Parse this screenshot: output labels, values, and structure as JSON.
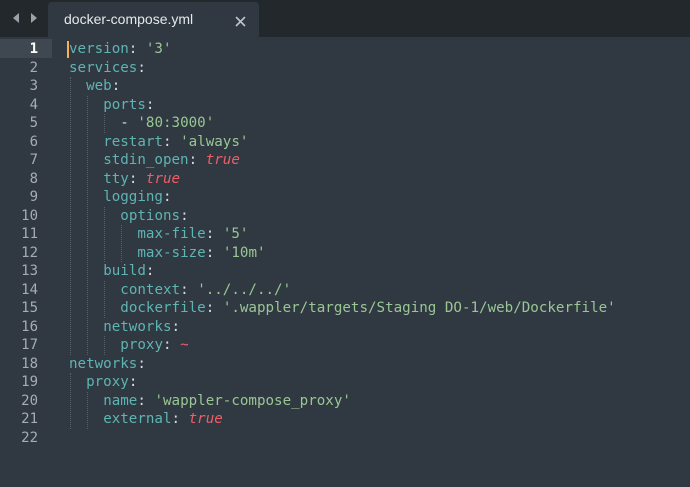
{
  "tab": {
    "title": "docker-compose.yml",
    "close_glyph": "×",
    "nav_back_icon": "chevron-left-icon",
    "nav_forward_icon": "chevron-right-icon"
  },
  "editor": {
    "active_line": 1,
    "colors": {
      "background": "#303841",
      "key": "#5fb4b4",
      "string": "#99c794",
      "boolean": "#ec5f67",
      "punctuation": "#d8dee9",
      "caret": "#f9ae58"
    },
    "line_numbers": [
      "1",
      "2",
      "3",
      "4",
      "5",
      "6",
      "7",
      "8",
      "9",
      "10",
      "11",
      "12",
      "13",
      "14",
      "15",
      "16",
      "17",
      "18",
      "19",
      "20",
      "21",
      "22"
    ],
    "lines": [
      {
        "indent": 0,
        "tokens": [
          {
            "t": "k",
            "v": "version"
          },
          {
            "t": "p",
            "v": ": "
          },
          {
            "t": "s",
            "v": "'3'"
          }
        ]
      },
      {
        "indent": 0,
        "tokens": [
          {
            "t": "k",
            "v": "services"
          },
          {
            "t": "p",
            "v": ":"
          }
        ]
      },
      {
        "indent": 1,
        "tokens": [
          {
            "t": "k",
            "v": "web"
          },
          {
            "t": "p",
            "v": ":"
          }
        ]
      },
      {
        "indent": 2,
        "tokens": [
          {
            "t": "k",
            "v": "ports"
          },
          {
            "t": "p",
            "v": ":"
          }
        ]
      },
      {
        "indent": 3,
        "tokens": [
          {
            "t": "p",
            "v": "- "
          },
          {
            "t": "s",
            "v": "'80:3000'"
          }
        ]
      },
      {
        "indent": 2,
        "tokens": [
          {
            "t": "k",
            "v": "restart"
          },
          {
            "t": "p",
            "v": ": "
          },
          {
            "t": "s",
            "v": "'always'"
          }
        ]
      },
      {
        "indent": 2,
        "tokens": [
          {
            "t": "k",
            "v": "stdin_open"
          },
          {
            "t": "p",
            "v": ": "
          },
          {
            "t": "b",
            "v": "true"
          }
        ]
      },
      {
        "indent": 2,
        "tokens": [
          {
            "t": "k",
            "v": "tty"
          },
          {
            "t": "p",
            "v": ": "
          },
          {
            "t": "b",
            "v": "true"
          }
        ]
      },
      {
        "indent": 2,
        "tokens": [
          {
            "t": "k",
            "v": "logging"
          },
          {
            "t": "p",
            "v": ":"
          }
        ]
      },
      {
        "indent": 3,
        "tokens": [
          {
            "t": "k",
            "v": "options"
          },
          {
            "t": "p",
            "v": ":"
          }
        ]
      },
      {
        "indent": 4,
        "tokens": [
          {
            "t": "k",
            "v": "max-file"
          },
          {
            "t": "p",
            "v": ": "
          },
          {
            "t": "s",
            "v": "'5'"
          }
        ]
      },
      {
        "indent": 4,
        "tokens": [
          {
            "t": "k",
            "v": "max-size"
          },
          {
            "t": "p",
            "v": ": "
          },
          {
            "t": "s",
            "v": "'10m'"
          }
        ]
      },
      {
        "indent": 2,
        "tokens": [
          {
            "t": "k",
            "v": "build"
          },
          {
            "t": "p",
            "v": ":"
          }
        ]
      },
      {
        "indent": 3,
        "tokens": [
          {
            "t": "k",
            "v": "context"
          },
          {
            "t": "p",
            "v": ": "
          },
          {
            "t": "s",
            "v": "'../../../'"
          }
        ]
      },
      {
        "indent": 3,
        "tokens": [
          {
            "t": "k",
            "v": "dockerfile"
          },
          {
            "t": "p",
            "v": ": "
          },
          {
            "t": "s",
            "v": "'.wappler/targets/Staging DO-1/web/Dockerfile'"
          }
        ]
      },
      {
        "indent": 2,
        "tokens": [
          {
            "t": "k",
            "v": "networks"
          },
          {
            "t": "p",
            "v": ":"
          }
        ]
      },
      {
        "indent": 3,
        "tokens": [
          {
            "t": "k",
            "v": "proxy"
          },
          {
            "t": "p",
            "v": ": "
          },
          {
            "t": "b",
            "v": "~"
          }
        ]
      },
      {
        "indent": 0,
        "tokens": [
          {
            "t": "k",
            "v": "networks"
          },
          {
            "t": "p",
            "v": ":"
          }
        ]
      },
      {
        "indent": 1,
        "tokens": [
          {
            "t": "k",
            "v": "proxy"
          },
          {
            "t": "p",
            "v": ":"
          }
        ]
      },
      {
        "indent": 2,
        "tokens": [
          {
            "t": "k",
            "v": "name"
          },
          {
            "t": "p",
            "v": ": "
          },
          {
            "t": "s",
            "v": "'wappler-compose_proxy'"
          }
        ]
      },
      {
        "indent": 2,
        "tokens": [
          {
            "t": "k",
            "v": "external"
          },
          {
            "t": "p",
            "v": ": "
          },
          {
            "t": "b",
            "v": "true"
          }
        ]
      },
      {
        "indent": 0,
        "tokens": []
      }
    ]
  }
}
